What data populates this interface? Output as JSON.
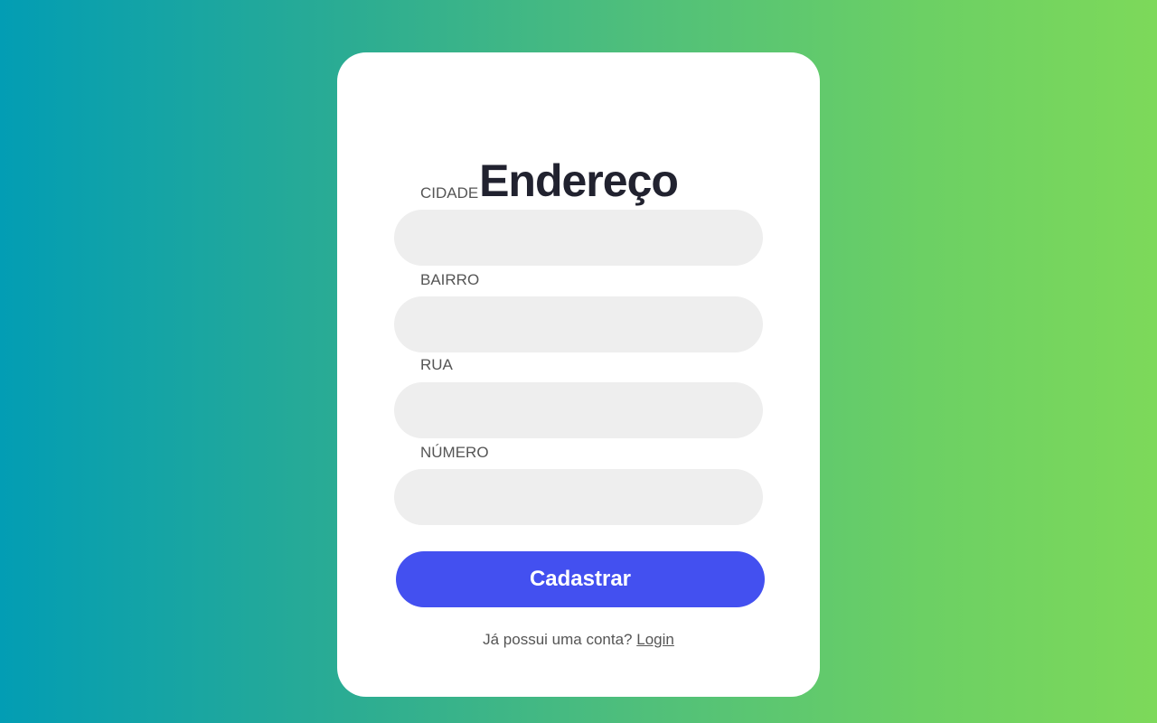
{
  "title": "Endereço",
  "fields": [
    {
      "label": "CIDADE",
      "value": ""
    },
    {
      "label": "BAIRRO",
      "value": ""
    },
    {
      "label": "RUA",
      "value": ""
    },
    {
      "label": "NÚMERO",
      "value": ""
    }
  ],
  "submit_label": "Cadastrar",
  "footer": {
    "text": "Já possui uma conta?",
    "link": "Login"
  },
  "colors": {
    "accent": "#4350f0",
    "input_bg": "#eeeeee",
    "title": "#21222f"
  }
}
